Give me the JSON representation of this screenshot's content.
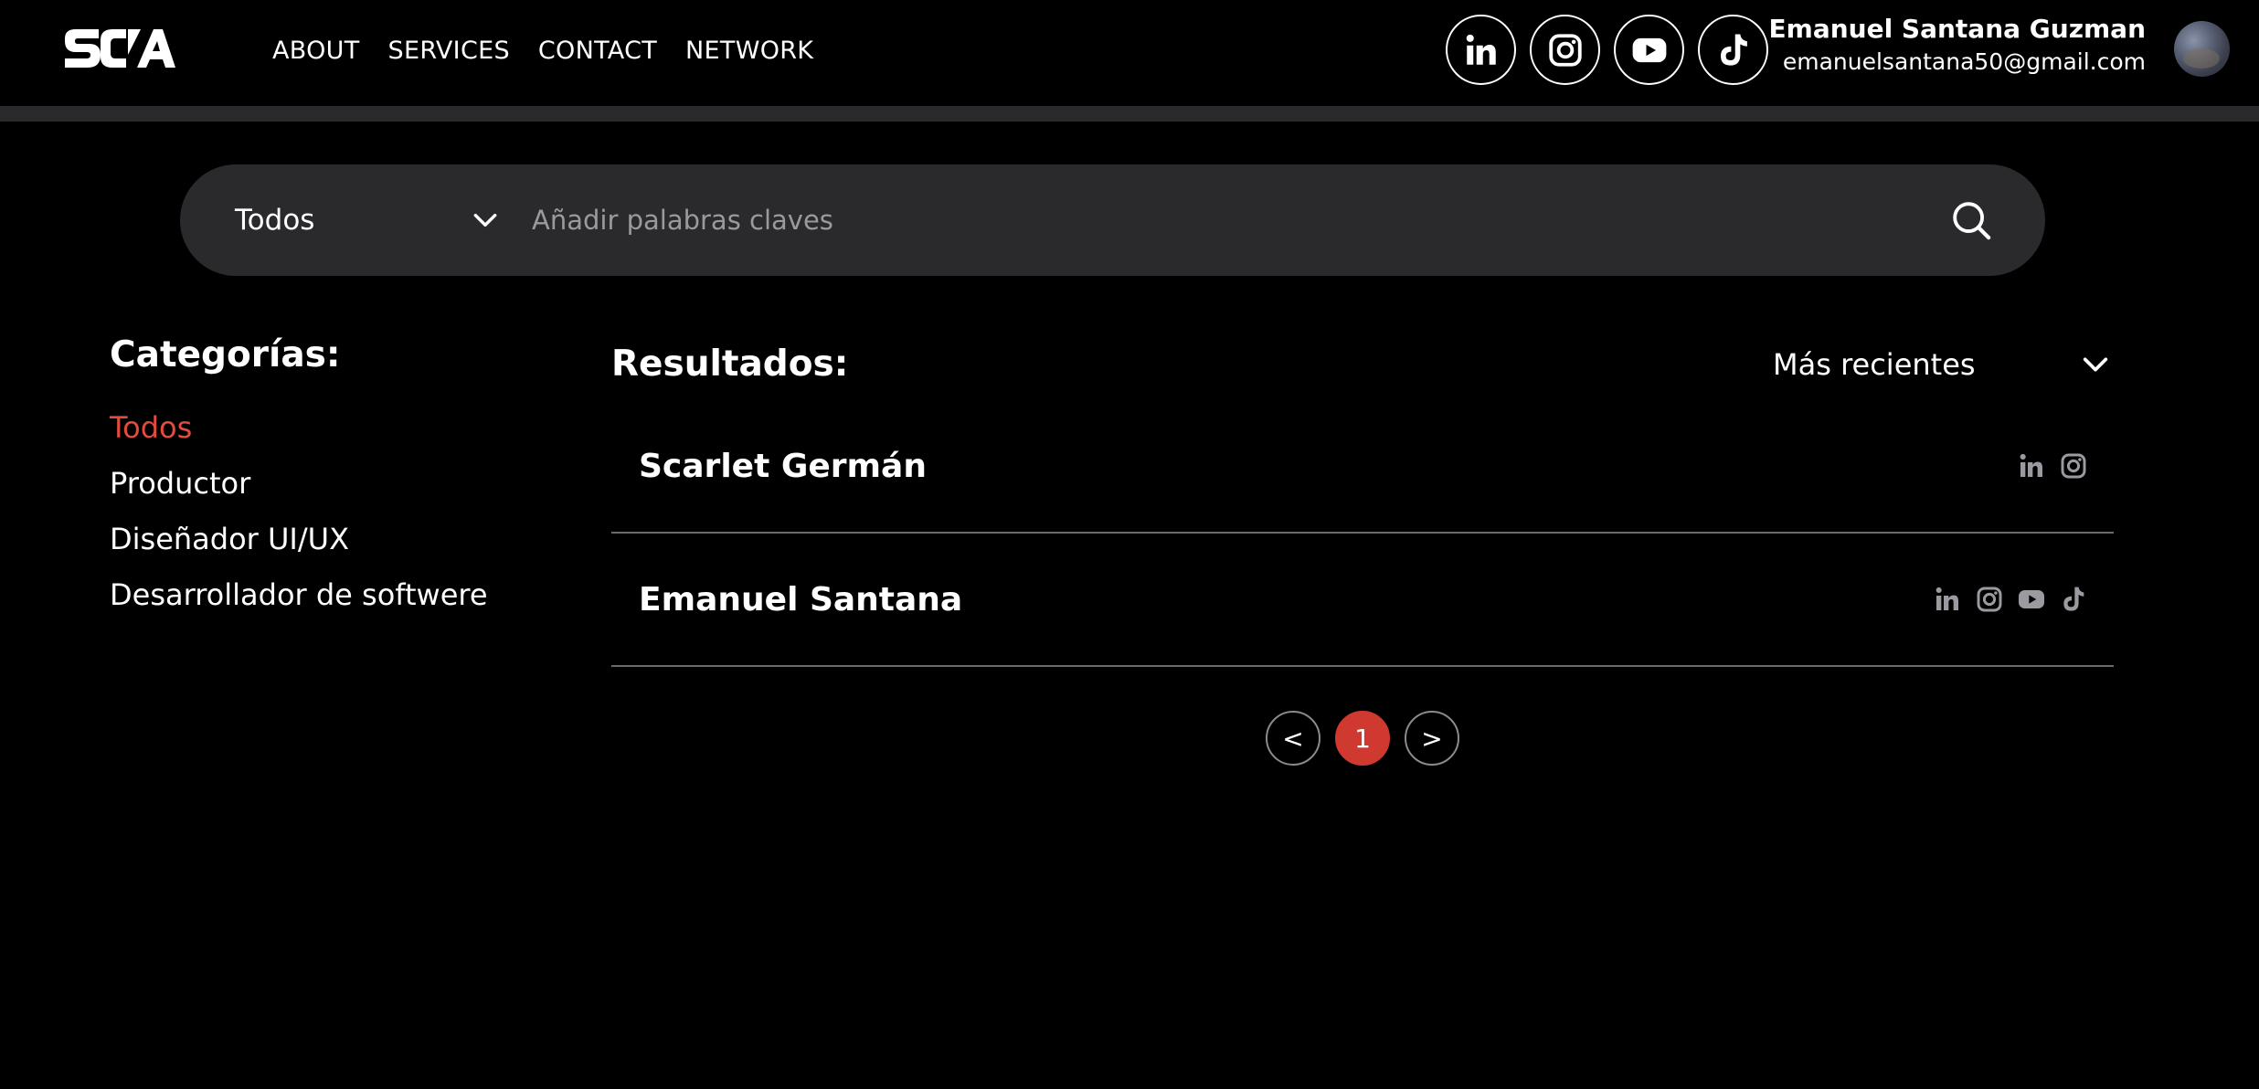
{
  "brand": {
    "logo_text": "SCA"
  },
  "nav": [
    {
      "label": "ABOUT"
    },
    {
      "label": "SERVICES"
    },
    {
      "label": "CONTACT"
    },
    {
      "label": "NETWORK"
    }
  ],
  "socials": [
    "linkedin-icon",
    "instagram-icon",
    "youtube-icon",
    "tiktok-icon"
  ],
  "user": {
    "name": "Emanuel Santana Guzman",
    "email": "emanuelsantana50@gmail.com"
  },
  "search": {
    "category_selected": "Todos",
    "placeholder": "Añadir palabras claves",
    "value": ""
  },
  "sidebar": {
    "title": "Categorías:",
    "items": [
      {
        "label": "Todos",
        "active": true
      },
      {
        "label": "Productor",
        "active": false
      },
      {
        "label": "Diseñador UI/UX",
        "active": false
      },
      {
        "label": "Desarrollador de softwere",
        "active": false
      }
    ]
  },
  "results": {
    "title": "Resultados:",
    "sort_label": "Más recientes",
    "items": [
      {
        "name": "Scarlet Germán",
        "icons": [
          "linkedin-icon",
          "instagram-icon"
        ]
      },
      {
        "name": "Emanuel Santana",
        "icons": [
          "linkedin-icon",
          "instagram-icon",
          "youtube-icon",
          "tiktok-icon"
        ]
      }
    ]
  },
  "pagination": {
    "prev": "<",
    "current": "1",
    "next": ">"
  },
  "colors": {
    "background": "#000000",
    "panel": "#2a2a2c",
    "accent": "#e24b3f",
    "page_active": "#d0392f",
    "muted_icon": "#9a9aa0",
    "divider": "#6b6b6e"
  }
}
